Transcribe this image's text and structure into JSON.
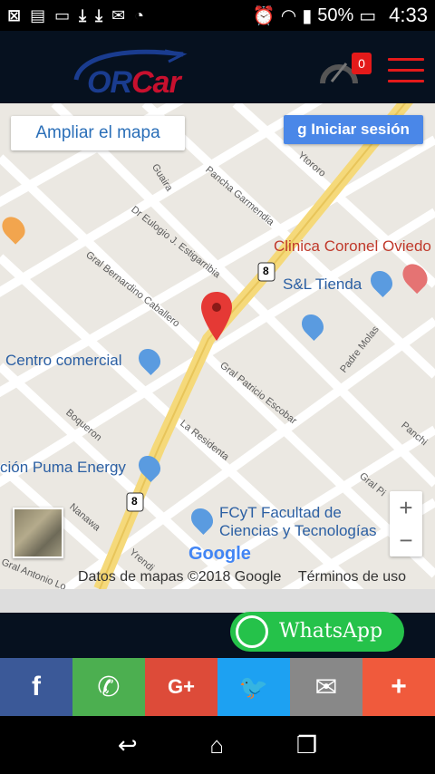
{
  "status": {
    "battery": "50%",
    "time": "4:33"
  },
  "header": {
    "logo": "ORCar",
    "cart_count": "0"
  },
  "map": {
    "expand_button": "Ampliar el mapa",
    "login_button": "Iniciar sesión",
    "streets": [
      "Guaira",
      "Pancha Garmendia",
      "Ytororo",
      "Dr Eulogio J. Estigarribia",
      "Gral Bernardino Caballero",
      "Gral Patricio Escobar",
      "La Residenta",
      "Boqueron",
      "Nanawa",
      "Padre Molas",
      "Panchi",
      "Gral Pi",
      "Yrendi",
      "Gral Antonio Lo"
    ],
    "pois": {
      "clinic": "Clinica Coronel Oviedo",
      "store": "S&L Tienda",
      "mall": "Centro comercial",
      "fuel": "ción Puma Energy",
      "faculty": "FCyT Facultad de",
      "faculty2": "Ciencias y Tecnologías"
    },
    "route_shield": "8",
    "google": "Google",
    "attribution": "Datos de mapas ©2018 Google",
    "terms": "Términos de uso"
  },
  "whatsapp_label": "WhatsApp",
  "share": [
    {
      "name": "facebook",
      "glyph": "f",
      "color": "#3b5998"
    },
    {
      "name": "whatsapp",
      "glyph": "✆",
      "color": "#4caf50"
    },
    {
      "name": "googleplus",
      "glyph": "G+",
      "color": "#dd4b39"
    },
    {
      "name": "twitter",
      "glyph": "🐦",
      "color": "#1da1f2"
    },
    {
      "name": "email",
      "glyph": "✉",
      "color": "#888888"
    },
    {
      "name": "more",
      "glyph": "+",
      "color": "#f05a3c"
    }
  ],
  "nav": [
    "↩",
    "⌂",
    "❐"
  ]
}
